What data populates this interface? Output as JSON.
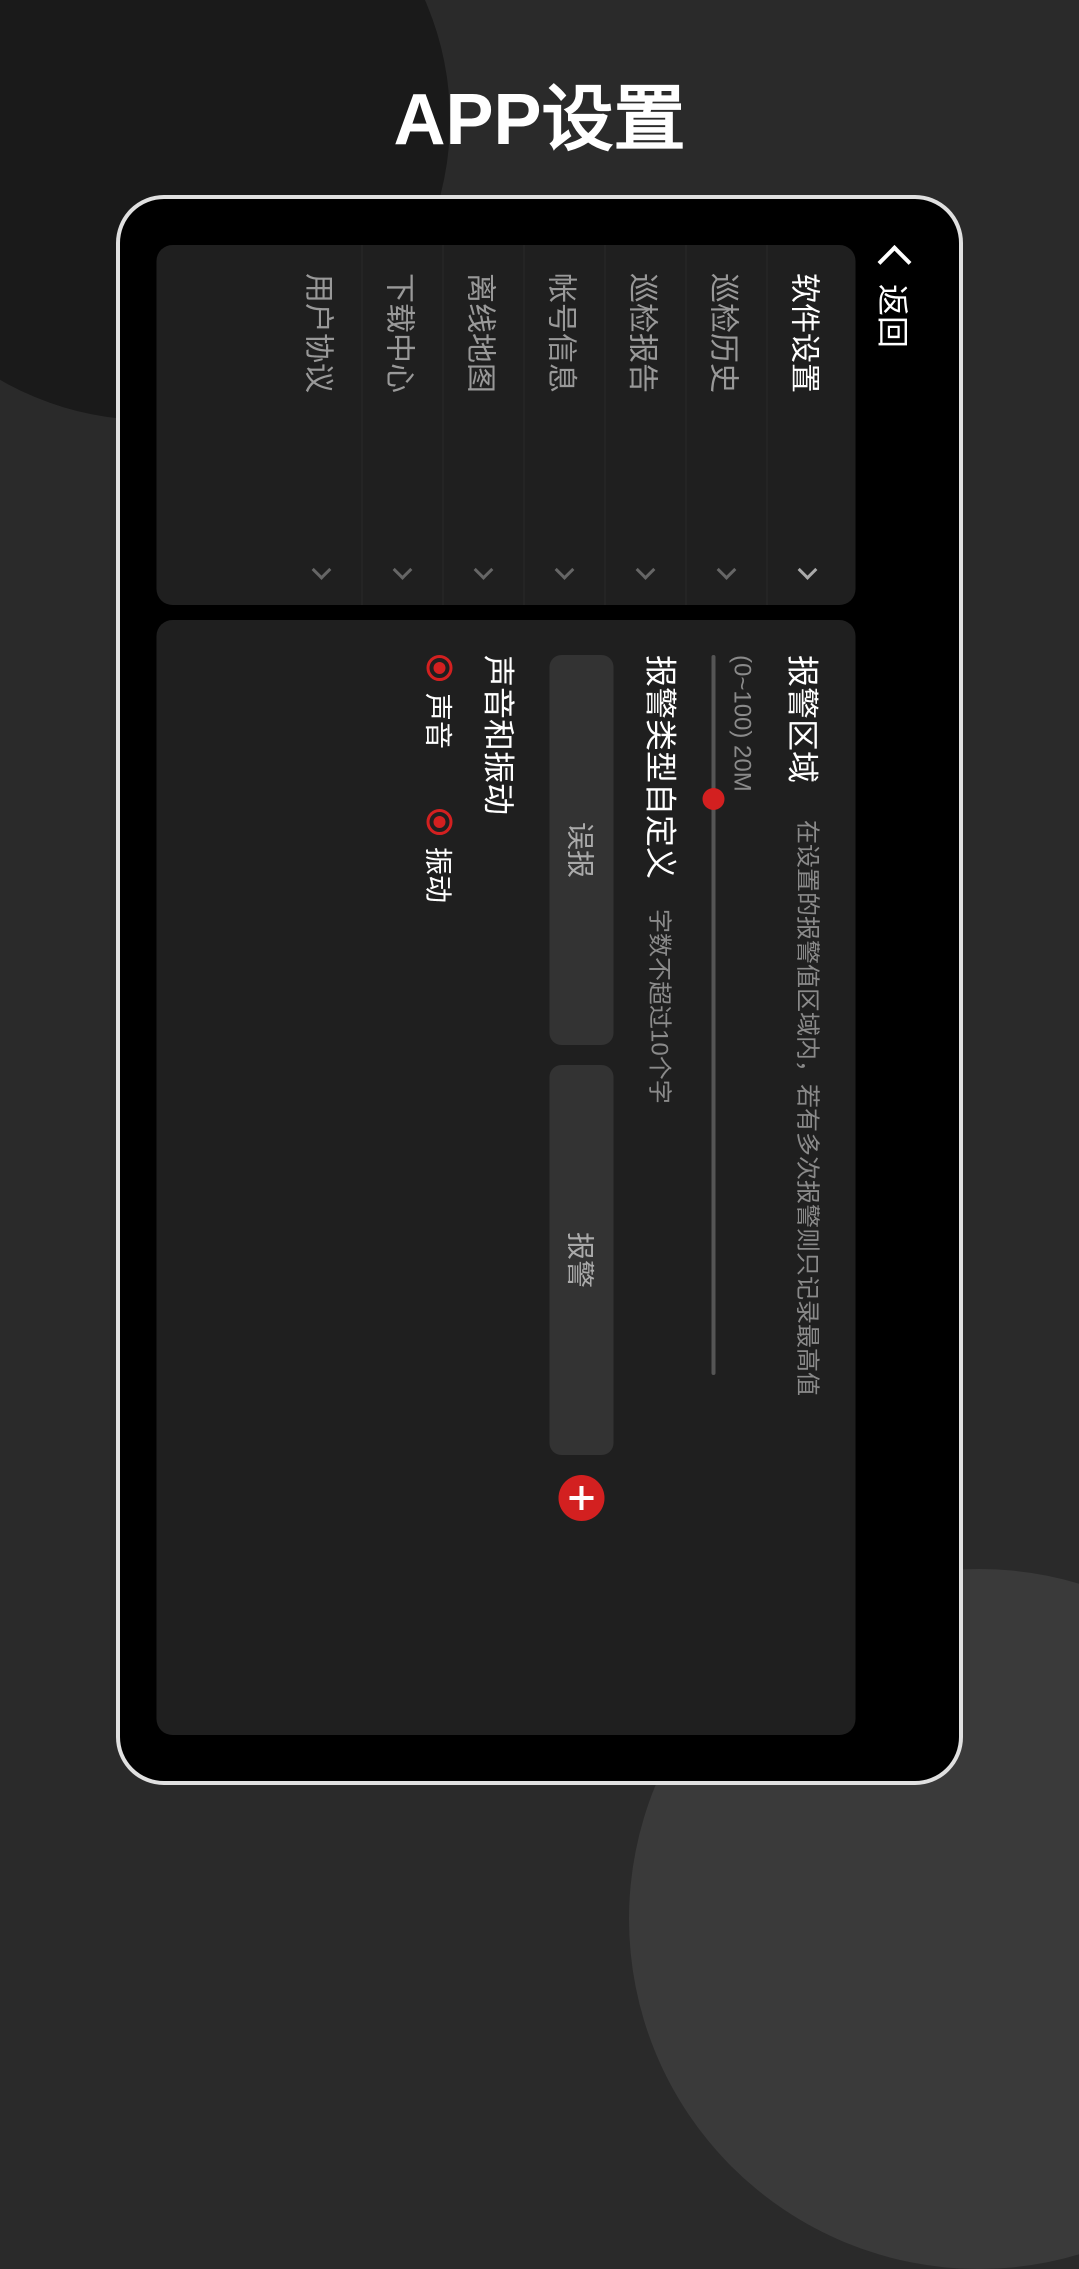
{
  "page_title": "APP设置",
  "back_label": "返回",
  "sidebar": {
    "items": [
      {
        "label": "软件设置",
        "selected": true
      },
      {
        "label": "巡检历史",
        "selected": false
      },
      {
        "label": "巡检报告",
        "selected": false
      },
      {
        "label": "帐号信息",
        "selected": false
      },
      {
        "label": "离线地图",
        "selected": false
      },
      {
        "label": "下载中心",
        "selected": false
      },
      {
        "label": "用户协议",
        "selected": false
      }
    ]
  },
  "alarm_area": {
    "title": "报警区域",
    "hint": "在设置的报警值区域内，若有多次报警则只记录最高值",
    "range_label": "(0~100) 20M",
    "value": 20,
    "min": 0,
    "max": 100
  },
  "custom_type": {
    "title": "报警类型自定义",
    "hint": "字数不超过10个字",
    "input1_value": "误报",
    "input2_value": "报警"
  },
  "sound_vibration": {
    "title": "声音和振动",
    "options": [
      {
        "label": "声音",
        "checked": true
      },
      {
        "label": "振动",
        "checked": true
      }
    ]
  },
  "colors": {
    "accent": "#d32020",
    "panel": "#1f1f1f",
    "bg": "#2a2a2a"
  }
}
